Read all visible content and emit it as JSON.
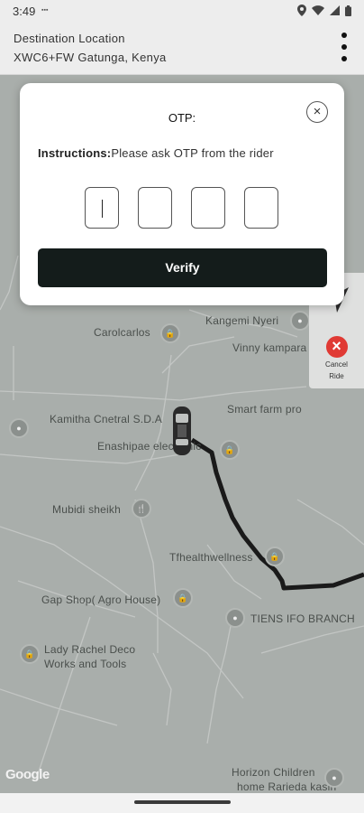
{
  "status_bar": {
    "time": "3:49",
    "small_text": "dots",
    "icons": [
      "location-icon",
      "wifi-icon",
      "signal-icon",
      "battery-icon"
    ]
  },
  "header": {
    "title": "Destination Location",
    "subtitle": "XWC6+FW Gatunga, Kenya"
  },
  "modal": {
    "title": "OTP:",
    "instructions_label": "Instructions:",
    "instructions_text": "Please ask OTP from the rider",
    "otp_values": [
      "",
      "",
      "",
      ""
    ],
    "verify_label": "Verify"
  },
  "map": {
    "pois": [
      {
        "label": "Carolcarlos"
      },
      {
        "label": "Kangemi Nyeri"
      },
      {
        "label": "Vinny kampara"
      },
      {
        "label": "Smart farm pro"
      },
      {
        "label": "Kamitha Cnetral S.D.A"
      },
      {
        "label": "Enashipae electronic"
      },
      {
        "label": "Mubidi sheikh"
      },
      {
        "label": "Tfhealthwellness"
      },
      {
        "label": "Gap Shop( Agro House)"
      },
      {
        "label": "TIENS IFO BRANCH"
      },
      {
        "label": "Lady Rachel Deco"
      },
      {
        "label": "Works and Tools"
      },
      {
        "label": "Horizon Children"
      },
      {
        "label": "home Rarieda kasin"
      }
    ],
    "google_label": "Google"
  },
  "side_panel": {
    "cancel_label_1": "Cancel",
    "cancel_label_2": "Ride"
  }
}
